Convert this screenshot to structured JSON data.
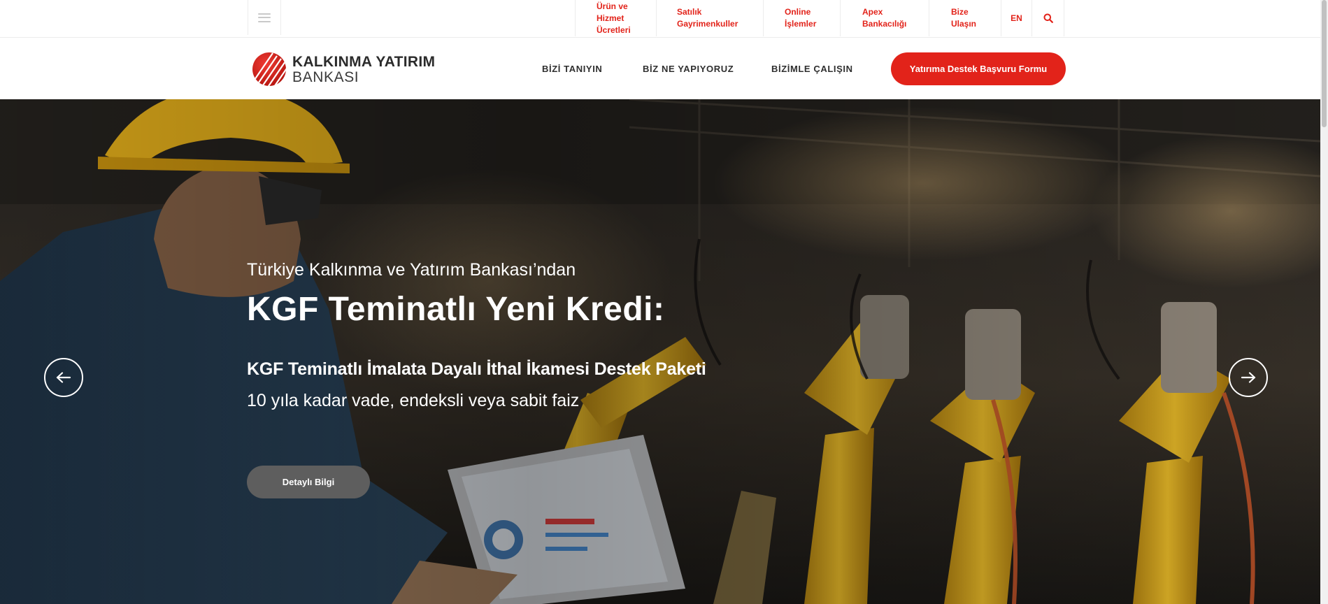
{
  "topbar": {
    "menu_icon": "hamburger-icon",
    "links": [
      {
        "label": "Ürün ve\nHizmet\nÜcretleri"
      },
      {
        "label": "Satılık\nGayrimenkuller"
      },
      {
        "label": "Online\nİşlemler"
      },
      {
        "label": "Apex\nBankacılığı"
      },
      {
        "label": "Bize\nUlaşın"
      }
    ],
    "language": "EN",
    "search_icon": "search-icon"
  },
  "header": {
    "logo": {
      "line1": "KALKINMA YATIRIM",
      "line2": "BANKASI"
    },
    "nav": [
      {
        "label": "BİZİ TANIYIN"
      },
      {
        "label": "BİZ NE YAPIYORUZ"
      },
      {
        "label": "BİZİMLE ÇALIŞIN"
      }
    ],
    "cta_label": "Yatırıma Destek Başvuru Formu"
  },
  "hero": {
    "kicker": "Türkiye Kalkınma ve Yatırım Bankası’ndan",
    "title": "KGF Teminatlı Yeni Kredi:",
    "subtitle": "KGF Teminatlı İmalata Dayalı İthal İkamesi Destek Paketi",
    "description": "10 yıla kadar vade, endeksli veya sabit faiz",
    "button_label": "Detaylı Bilgi",
    "prev_icon": "arrow-left-icon",
    "next_icon": "arrow-right-icon"
  },
  "colors": {
    "brand_red": "#e2231a",
    "text_dark": "#2f2f2f",
    "hero_button": "#5e5e5e"
  }
}
